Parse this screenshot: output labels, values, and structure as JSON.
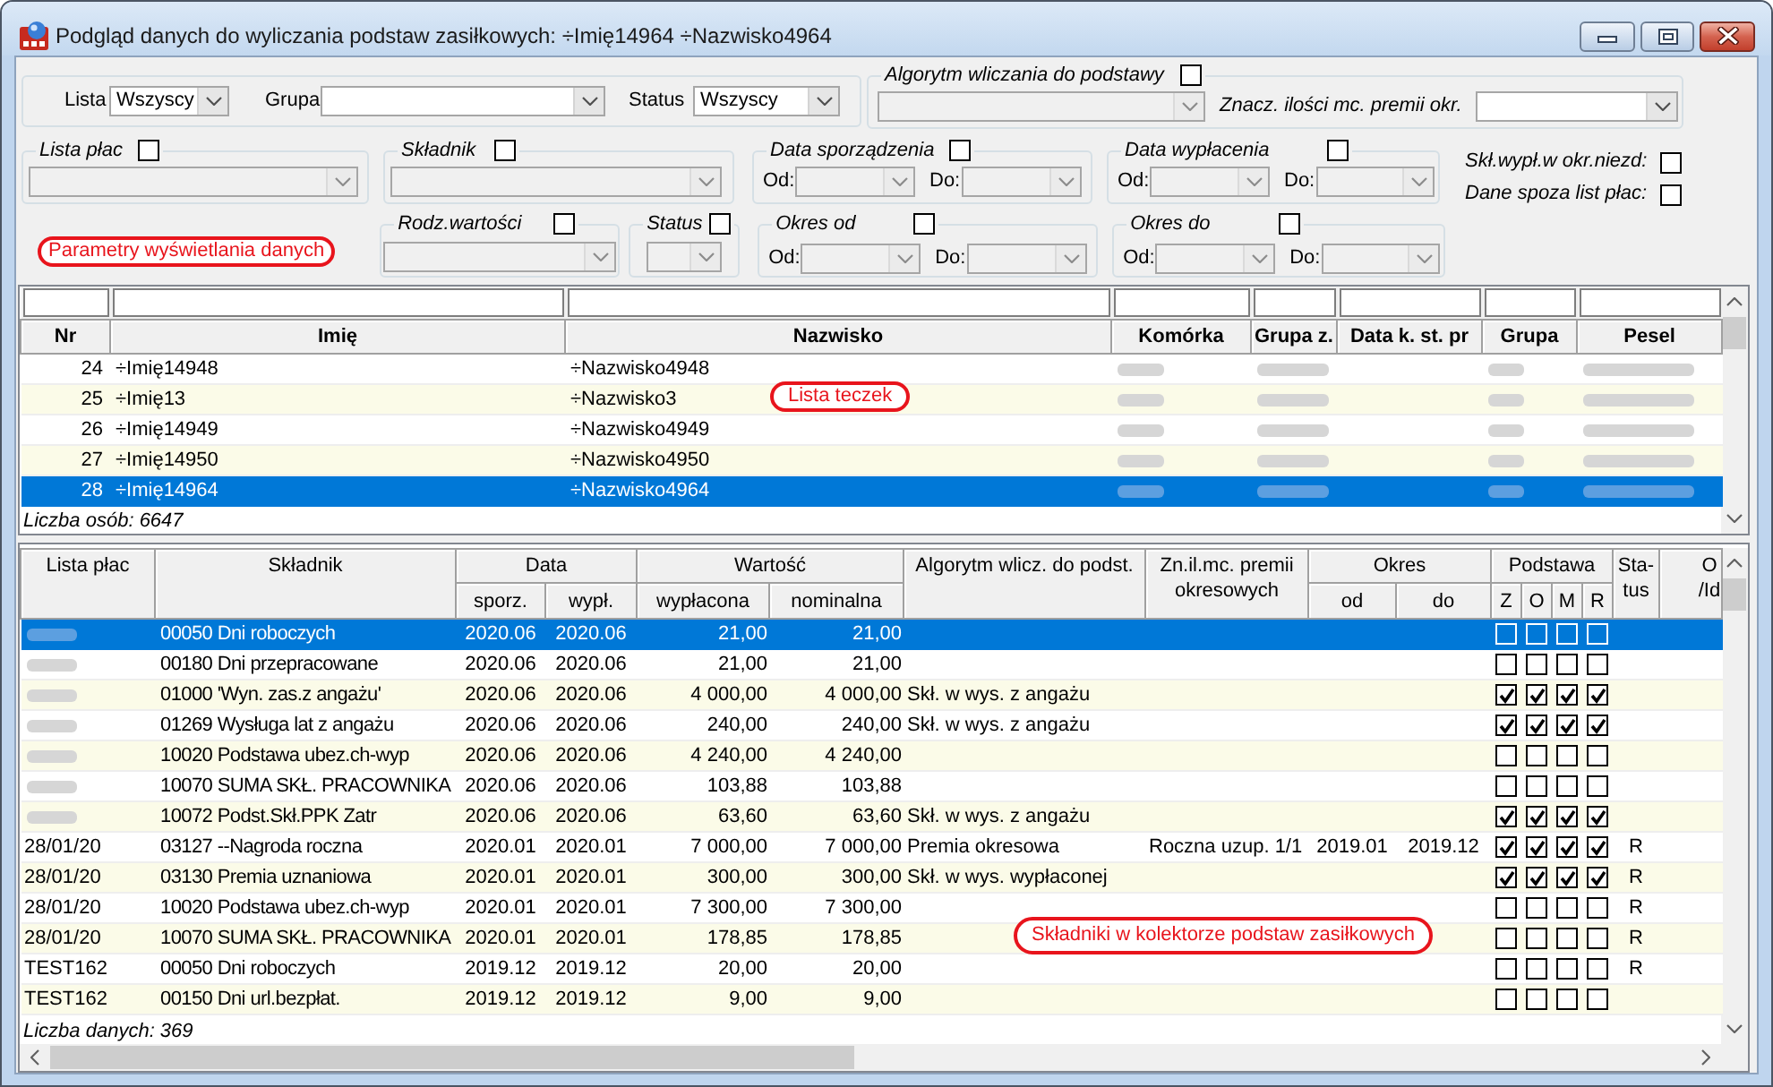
{
  "window": {
    "title": "Podgląd danych do wyliczania podstaw zasiłkowych: ÷Imię14964 ÷Nazwisko4964"
  },
  "filter_bar": {
    "fields": [
      {
        "label": "Lista",
        "combo": {
          "value": "Wszyscy",
          "disabled": false
        }
      },
      {
        "label": "Grupa",
        "combo": {
          "disabled": false
        }
      },
      {
        "label": "Status",
        "combo": {
          "value": "Wszyscy",
          "disabled": false
        }
      }
    ],
    "algorithm": {
      "label": "Algorytm wliczania do podstawy",
      "checked": false,
      "combo": {
        "disabled": true
      },
      "premium_label": "Znacz. ilości mc. premii okr.",
      "premium_combo": {
        "disabled": false
      }
    }
  },
  "filter_groups": [
    {
      "label": "Lista płac",
      "checked": false,
      "combos": [
        {
          "disabled": true
        }
      ]
    },
    {
      "label": "Składnik",
      "checked": false,
      "combos": [
        {
          "disabled": true
        }
      ]
    },
    {
      "label": "Data sporządzenia",
      "checked": false,
      "combos": [
        {
          "label": "Od:",
          "disabled": true
        },
        {
          "label": "Do:",
          "disabled": true
        }
      ]
    },
    {
      "label": "Data wypłacenia",
      "checked": false,
      "combos": [
        {
          "label": "Od:",
          "disabled": true
        },
        {
          "label": "Do:",
          "disabled": true
        }
      ]
    }
  ],
  "options": [
    {
      "label": "Skł.wypł.w okr.niezd:",
      "checked": false
    },
    {
      "label": "Dane spoza list płac:",
      "checked": false
    }
  ],
  "params_annotation": "Parametry wyświetlania danych",
  "filter_groups_2": [
    {
      "label": "Rodz.wartości",
      "checked": false,
      "combos": [
        {
          "disabled": true
        }
      ]
    },
    {
      "label": "Status",
      "checked": false,
      "combos": [
        {
          "disabled": true
        }
      ]
    },
    {
      "label": "Okres od",
      "checked": false,
      "combos": [
        {
          "label": "Od:",
          "disabled": true
        },
        {
          "label": "Do:",
          "disabled": true
        }
      ]
    },
    {
      "label": "Okres do",
      "checked": false,
      "combos": [
        {
          "label": "Od:",
          "disabled": true
        },
        {
          "label": "Do:",
          "disabled": true
        }
      ]
    }
  ],
  "people_table": {
    "columns": [
      {
        "label": "Nr",
        "blurred": false
      },
      {
        "label": "Imię",
        "blurred": false
      },
      {
        "label": "Nazwisko",
        "blurred": false
      },
      {
        "label": "Komórka",
        "blurred": true
      },
      {
        "label": "Grupa z.",
        "blurred": true
      },
      {
        "label": "Data k. st. pr",
        "blurred": false
      },
      {
        "label": "Grupa",
        "blurred": true
      },
      {
        "label": "Pesel",
        "blurred": true
      }
    ],
    "rows": [
      {
        "cells": [
          "24",
          "÷Imię14948",
          "÷Nazwisko4948"
        ],
        "selected": false
      },
      {
        "cells": [
          "25",
          "÷Imię13",
          "÷Nazwisko3"
        ],
        "selected": false
      },
      {
        "cells": [
          "26",
          "÷Imię14949",
          "÷Nazwisko4949"
        ],
        "selected": false
      },
      {
        "cells": [
          "27",
          "÷Imię14950",
          "÷Nazwisko4950"
        ],
        "selected": false
      },
      {
        "cells": [
          "28",
          "÷Imię14964",
          "÷Nazwisko4964"
        ],
        "selected": true
      }
    ],
    "footer": "Liczba osób: 6647",
    "annotation": "Lista teczek"
  },
  "components_table": {
    "columns": [
      {
        "label": "Lista płac"
      },
      {
        "label": "Składnik"
      },
      {
        "label": "Data",
        "children": [
          {
            "label": "sporz."
          },
          {
            "label": "wypł."
          }
        ]
      },
      {
        "label": "Wartość",
        "children": [
          {
            "label": "wypłacona"
          },
          {
            "label": "nominalna"
          }
        ]
      },
      {
        "label": "Algorytm wlicz. do podst."
      },
      {
        "label": "Zn.il.mc. premii okresowych"
      },
      {
        "label": "Okres",
        "children": [
          {
            "label": "od"
          },
          {
            "label": "do"
          }
        ]
      },
      {
        "label": "Podstawa",
        "children": [
          {
            "label": "Z"
          },
          {
            "label": "O"
          },
          {
            "label": "M"
          },
          {
            "label": "R"
          }
        ]
      },
      {
        "label": "Sta-tus"
      },
      {
        "label": "O /Id"
      }
    ],
    "rows": [
      {
        "lista_plac_blurred": true,
        "skladnik": "00050 Dni roboczych",
        "sporz": "2020.06",
        "wypl": "2020.06",
        "wyplacona": "21,00",
        "nominalna": "21,00",
        "podstawa": [
          {
            "checked": false
          },
          {
            "checked": false
          },
          {
            "checked": false
          },
          {
            "checked": false
          }
        ],
        "selected": true
      },
      {
        "lista_plac_blurred": true,
        "skladnik": "00180 Dni przepracowane",
        "sporz": "2020.06",
        "wypl": "2020.06",
        "wyplacona": "21,00",
        "nominalna": "21,00",
        "podstawa": [
          {
            "checked": false
          },
          {
            "checked": false
          },
          {
            "checked": false
          },
          {
            "checked": false
          }
        ],
        "selected": false
      },
      {
        "lista_plac_blurred": true,
        "skladnik": "01000 'Wyn. zas.z angażu'",
        "sporz": "2020.06",
        "wypl": "2020.06",
        "wyplacona": "4 000,00",
        "nominalna": "4 000,00",
        "algorytm": "Skł. w wys. z angażu",
        "podstawa": [
          {
            "checked": true
          },
          {
            "checked": true
          },
          {
            "checked": true
          },
          {
            "checked": true
          }
        ],
        "selected": false
      },
      {
        "lista_plac_blurred": true,
        "skladnik": "01269 Wysługa lat z angażu",
        "sporz": "2020.06",
        "wypl": "2020.06",
        "wyplacona": "240,00",
        "nominalna": "240,00",
        "algorytm": "Skł. w wys. z angażu",
        "podstawa": [
          {
            "checked": true
          },
          {
            "checked": true
          },
          {
            "checked": true
          },
          {
            "checked": true
          }
        ],
        "selected": false
      },
      {
        "lista_plac_blurred": true,
        "skladnik": "10020 Podstawa ubez.ch-wyp",
        "sporz": "2020.06",
        "wypl": "2020.06",
        "wyplacona": "4 240,00",
        "nominalna": "4 240,00",
        "podstawa": [
          {
            "checked": false
          },
          {
            "checked": false
          },
          {
            "checked": false
          },
          {
            "checked": false
          }
        ],
        "selected": false
      },
      {
        "lista_plac_blurred": true,
        "skladnik": "10070 SUMA SKŁ. PRACOWNIKA",
        "sporz": "2020.06",
        "wypl": "2020.06",
        "wyplacona": "103,88",
        "nominalna": "103,88",
        "podstawa": [
          {
            "checked": false
          },
          {
            "checked": false
          },
          {
            "checked": false
          },
          {
            "checked": false
          }
        ],
        "selected": false
      },
      {
        "lista_plac_blurred": true,
        "skladnik": "10072 Podst.Skł.PPK Zatr",
        "sporz": "2020.06",
        "wypl": "2020.06",
        "wyplacona": "63,60",
        "nominalna": "63,60",
        "algorytm": "Skł. w wys. z angażu",
        "podstawa": [
          {
            "checked": true
          },
          {
            "checked": true
          },
          {
            "checked": true
          },
          {
            "checked": true
          }
        ],
        "selected": false
      },
      {
        "lista_plac": "28/01/20",
        "lista_plac_blurred": false,
        "skladnik": "03127 --Nagroda roczna",
        "sporz": "2020.01",
        "wypl": "2020.01",
        "wyplacona": "7 000,00",
        "nominalna": "7 000,00",
        "algorytm": "Premia okresowa",
        "zn_premii": "Roczna uzup. 1/1",
        "okres_od": "2019.01",
        "okres_do": "2019.12",
        "podstawa": [
          {
            "checked": true
          },
          {
            "checked": true
          },
          {
            "checked": true
          },
          {
            "checked": true
          }
        ],
        "status": "R",
        "selected": false
      },
      {
        "lista_plac": "28/01/20",
        "lista_plac_blurred": false,
        "skladnik": "03130 Premia uznaniowa",
        "sporz": "2020.01",
        "wypl": "2020.01",
        "wyplacona": "300,00",
        "nominalna": "300,00",
        "algorytm": "Skł. w wys. wypłaconej",
        "podstawa": [
          {
            "checked": true
          },
          {
            "checked": true
          },
          {
            "checked": true
          },
          {
            "checked": true
          }
        ],
        "status": "R",
        "selected": false
      },
      {
        "lista_plac": "28/01/20",
        "lista_plac_blurred": false,
        "skladnik": "10020 Podstawa ubez.ch-wyp",
        "sporz": "2020.01",
        "wypl": "2020.01",
        "wyplacona": "7 300,00",
        "nominalna": "7 300,00",
        "podstawa": [
          {
            "checked": false
          },
          {
            "checked": false
          },
          {
            "checked": false
          },
          {
            "checked": false
          }
        ],
        "status": "R",
        "selected": false
      },
      {
        "lista_plac": "28/01/20",
        "lista_plac_blurred": false,
        "skladnik": "10070 SUMA SKŁ. PRACOWNIKA",
        "sporz": "2020.01",
        "wypl": "2020.01",
        "wyplacona": "178,85",
        "nominalna": "178,85",
        "podstawa": [
          {
            "checked": false
          },
          {
            "checked": false
          },
          {
            "checked": false
          },
          {
            "checked": false
          }
        ],
        "status": "R",
        "selected": false
      },
      {
        "lista_plac": "TEST162",
        "lista_plac_blurred": false,
        "skladnik": "00050 Dni roboczych",
        "sporz": "2019.12",
        "wypl": "2019.12",
        "wyplacona": "20,00",
        "nominalna": "20,00",
        "podstawa": [
          {
            "checked": false
          },
          {
            "checked": false
          },
          {
            "checked": false
          },
          {
            "checked": false
          }
        ],
        "status": "R",
        "selected": false
      },
      {
        "lista_plac": "TEST162",
        "lista_plac_blurred": false,
        "skladnik": "00150 Dni url.bezpłat.",
        "sporz": "2019.12",
        "wypl": "2019.12",
        "wyplacona": "9,00",
        "nominalna": "9,00",
        "podstawa": [
          {
            "checked": false
          },
          {
            "checked": false
          },
          {
            "checked": false
          },
          {
            "checked": false
          }
        ],
        "selected": false
      }
    ],
    "footer": "Liczba danych: 369",
    "annotation": "Składniki w kolektorze podstaw zasiłkowych"
  }
}
